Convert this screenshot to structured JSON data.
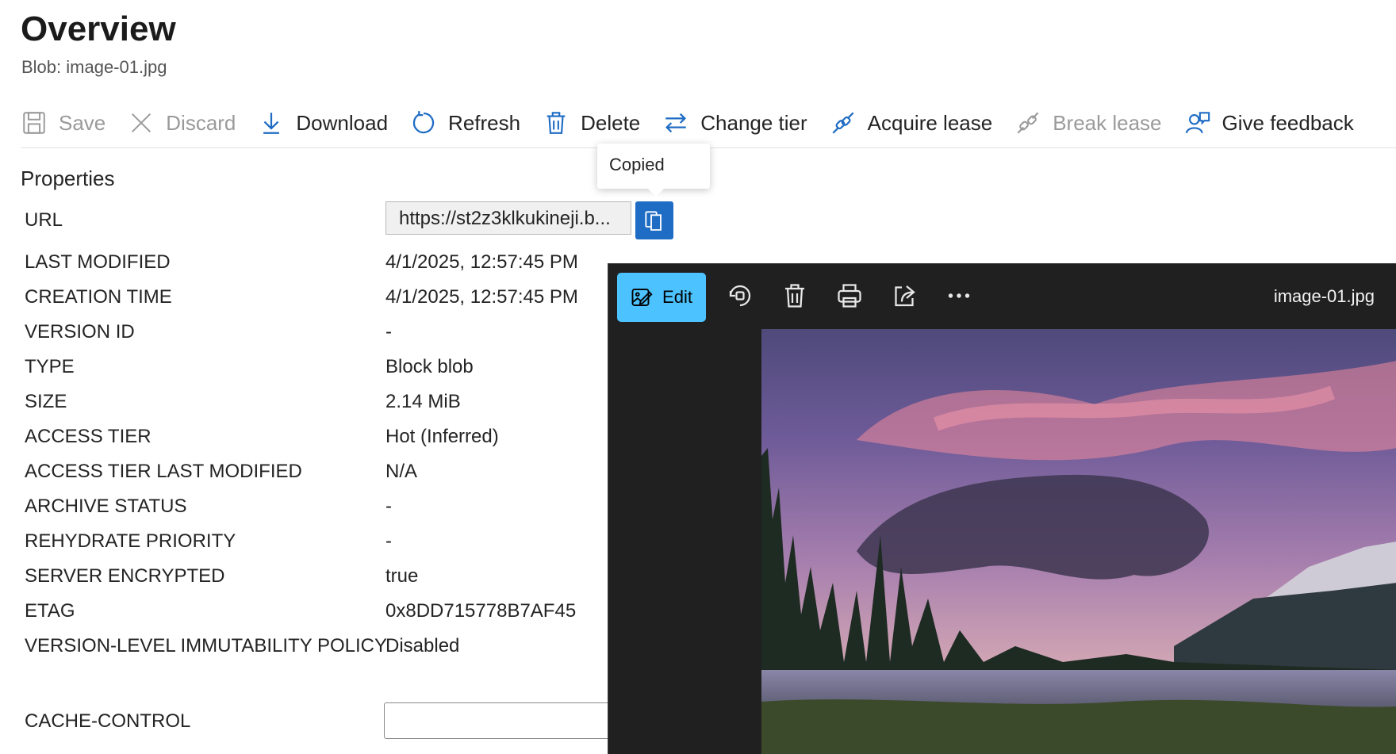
{
  "header": {
    "title": "Overview",
    "subtitle": "Blob: image-01.jpg"
  },
  "toolbar": {
    "save": "Save",
    "discard": "Discard",
    "download": "Download",
    "refresh": "Refresh",
    "delete": "Delete",
    "change_tier": "Change tier",
    "acquire_lease": "Acquire lease",
    "break_lease": "Break lease",
    "give_feedback": "Give feedback"
  },
  "properties": {
    "section_title": "Properties",
    "url_label": "URL",
    "url_value": "https://st2z3klkukineji.b...",
    "copied_tooltip": "Copied",
    "rows": [
      {
        "label": "LAST MODIFIED",
        "value": "4/1/2025, 12:57:45 PM"
      },
      {
        "label": "CREATION TIME",
        "value": "4/1/2025, 12:57:45 PM"
      },
      {
        "label": "VERSION ID",
        "value": "-"
      },
      {
        "label": "TYPE",
        "value": "Block blob"
      },
      {
        "label": "SIZE",
        "value": "2.14 MiB"
      },
      {
        "label": "ACCESS TIER",
        "value": "Hot (Inferred)"
      },
      {
        "label": "ACCESS TIER LAST MODIFIED",
        "value": "N/A"
      },
      {
        "label": "ARCHIVE STATUS",
        "value": "-"
      },
      {
        "label": "REHYDRATE PRIORITY",
        "value": "-"
      },
      {
        "label": "SERVER ENCRYPTED",
        "value": "true"
      },
      {
        "label": "ETAG",
        "value": "0x8DD715778B7AF45"
      },
      {
        "label": "VERSION-LEVEL IMMUTABILITY POLICY",
        "value": "Disabled"
      }
    ],
    "cache_control_label": "CACHE-CONTROL",
    "cache_control_value": ""
  },
  "viewer": {
    "edit_label": "Edit",
    "filename": "image-01.jpg",
    "icons": [
      "edit-icon",
      "rotate-icon",
      "delete-icon",
      "print-icon",
      "share-icon",
      "more-icon"
    ]
  },
  "colors": {
    "accent": "#1f6cc4",
    "viewer_edit": "#4cc2ff",
    "viewer_bg": "#202020"
  }
}
